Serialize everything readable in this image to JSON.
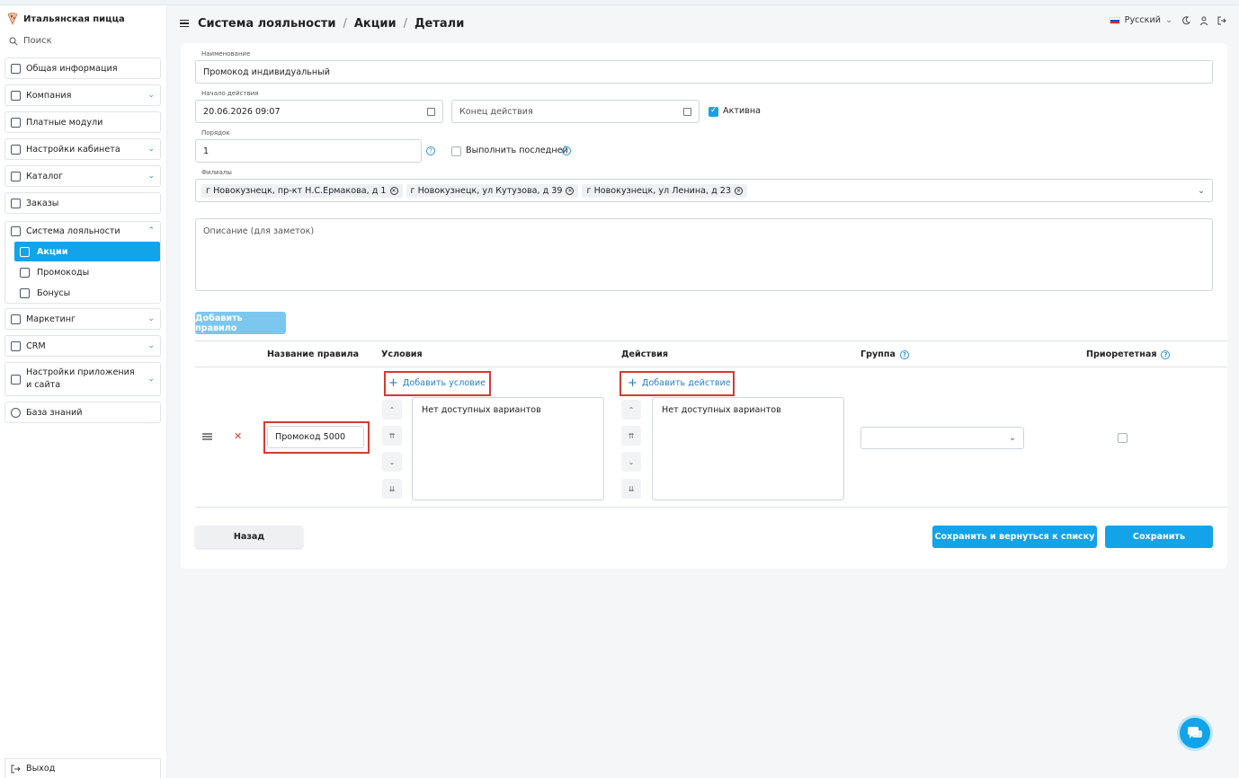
{
  "brand": {
    "name": "Итальянская пицца"
  },
  "sidebar": {
    "search_label": "Поиск",
    "items": [
      {
        "label": "Общая информация",
        "icon": "document-icon",
        "expandable": false
      },
      {
        "label": "Компания",
        "icon": "bank-icon",
        "expandable": true
      },
      {
        "label": "Платные модули",
        "icon": "coins-icon",
        "expandable": false
      },
      {
        "label": "Настройки кабинета",
        "icon": "cabinet-icon",
        "expandable": true
      },
      {
        "label": "Каталог",
        "icon": "catalog-icon",
        "expandable": true
      },
      {
        "label": "Заказы",
        "icon": "cloche-icon",
        "expandable": false
      }
    ],
    "loyalty": {
      "label": "Система лояльности",
      "icon": "loyalty-icon",
      "sub": [
        {
          "label": "Акции",
          "icon": "promo-icon",
          "active": true
        },
        {
          "label": "Промокоды",
          "icon": "promocode-icon",
          "active": false
        },
        {
          "label": "Бонусы",
          "icon": "tag-icon",
          "active": false
        }
      ]
    },
    "items2": [
      {
        "label": "Маркетинг",
        "icon": "megaphone-icon",
        "expandable": true
      },
      {
        "label": "CRM",
        "icon": "crm-icon",
        "expandable": true
      },
      {
        "label": "Настройки приложения и сайта",
        "icon": "devices-icon",
        "expandable": true
      },
      {
        "label": "База знаний",
        "icon": "help-icon",
        "expandable": false
      }
    ],
    "logout_label": "Выход"
  },
  "header": {
    "crumbs": [
      "Система лояльности",
      "Акции",
      "Детали"
    ],
    "separator": "/",
    "language": "Русский"
  },
  "form": {
    "name_label": "Наименование",
    "name_value": "Промокод индивидуальный",
    "start_label": "Начало действия",
    "start_value": "20.06.2026 09:07",
    "end_placeholder": "Конец действия",
    "active_label": "Активна",
    "active_checked": true,
    "order_label": "Порядок",
    "order_value": "1",
    "last_label": "Выполнить последней",
    "last_checked": false,
    "branches_label": "Филиалы",
    "branches": [
      "г Новокузнецк, пр-кт Н.С.Ермакова, д 1",
      "г Новокузнецк, ул Кутузова, д 39",
      "г Новокузнецк, ул Ленина, д 23"
    ],
    "description_placeholder": "Описание (для заметок)",
    "add_rule_label": "Добавить правило"
  },
  "rules_table": {
    "headers": {
      "name": "Название правила",
      "conditions": "Условия",
      "actions": "Действия",
      "group": "Группа",
      "priority": "Приорететная"
    },
    "row": {
      "name_value": "Промокод 5000",
      "add_condition_label": "Добавить условие",
      "add_action_label": "Добавить действие",
      "conditions_empty": "Нет доступных вариантов",
      "actions_empty": "Нет доступных вариантов",
      "group_value": "",
      "priority_checked": false
    }
  },
  "footer": {
    "back_label": "Назад",
    "save_return_label": "Сохранить и вернуться к списку",
    "save_label": "Сохранить"
  },
  "colors": {
    "accent": "#12a3e8",
    "highlight": "#d23b32",
    "link": "#2a7fc2"
  }
}
